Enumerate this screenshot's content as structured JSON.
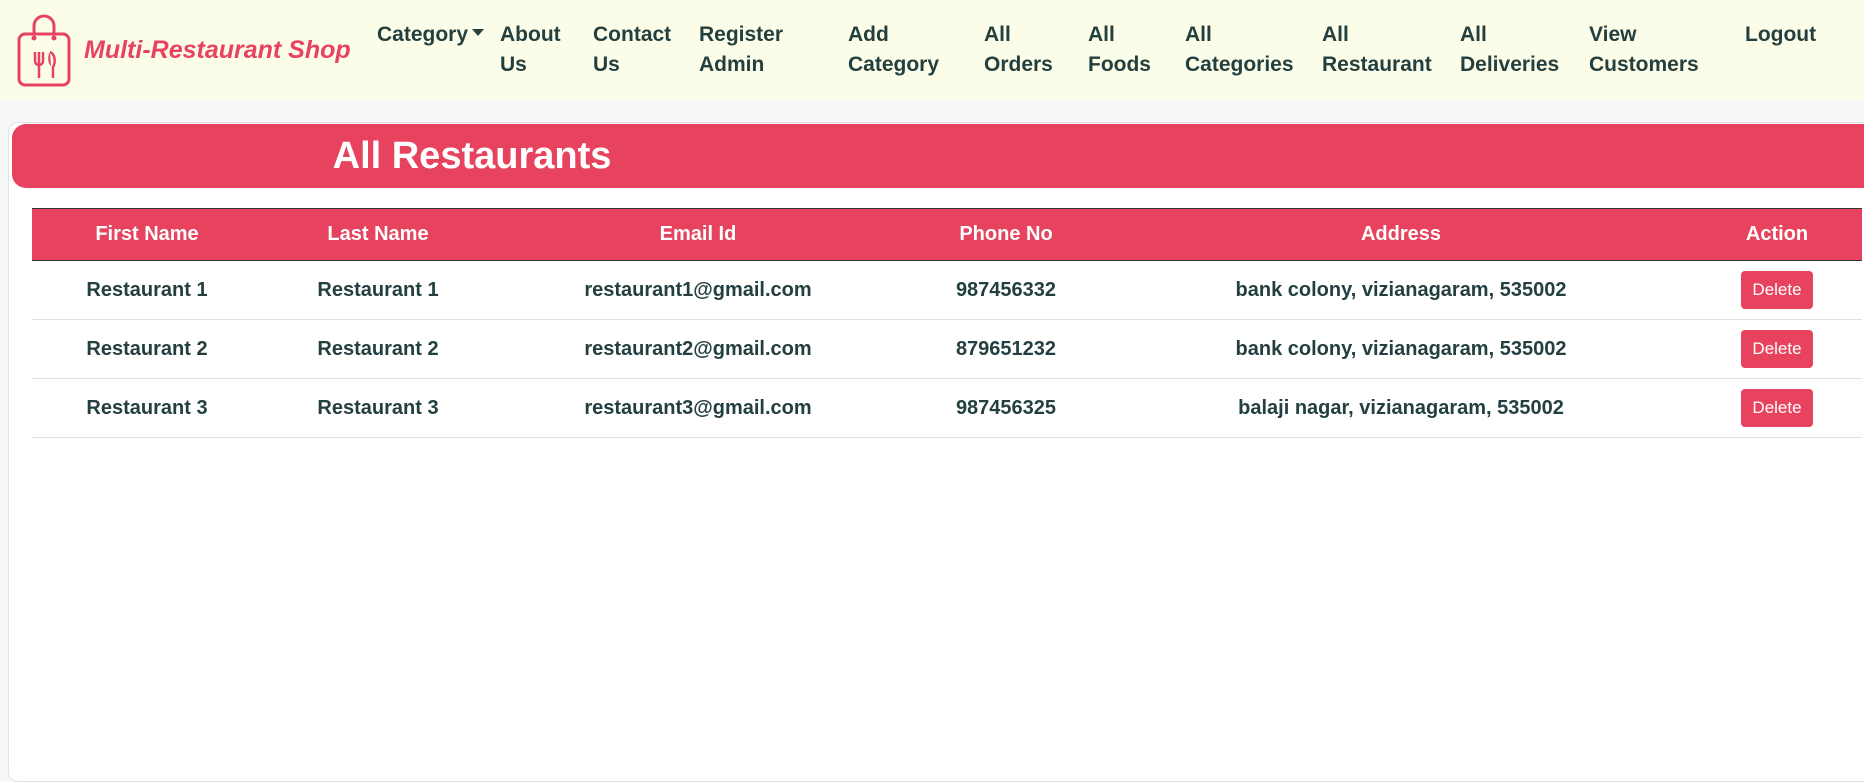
{
  "brand": {
    "name": "Multi-Restaurant Shop",
    "logo_icon": "shopping-bag-utensils-icon",
    "accent": "#e8435e"
  },
  "nav": {
    "category": "Category",
    "about_1": "About",
    "about_2": "Us",
    "contact_1": "Contact",
    "contact_2": "Us",
    "register_1": "Register",
    "register_2": "Admin",
    "addcat_1": "Add",
    "addcat_2": "Category",
    "orders_1": "All",
    "orders_2": "Orders",
    "foods_1": "All",
    "foods_2": "Foods",
    "cats_1": "All",
    "cats_2": "Categories",
    "rest_1": "All",
    "rest_2": "Restaurant",
    "deliv_1": "All",
    "deliv_2": "Deliveries",
    "cust_1": "View",
    "cust_2": "Customers",
    "logout": "Logout"
  },
  "page": {
    "title": "All Restaurants"
  },
  "table": {
    "headers": [
      "First Name",
      "Last Name",
      "Email Id",
      "Phone No",
      "Address",
      "Action"
    ],
    "rows": [
      [
        "Restaurant 1",
        "Restaurant 1",
        "restaurant1@gmail.com",
        "987456332",
        "bank colony, vizianagaram, 535002",
        "Delete"
      ],
      [
        "Restaurant 2",
        "Restaurant 2",
        "restaurant2@gmail.com",
        "879651232",
        "bank colony, vizianagaram, 535002",
        "Delete"
      ],
      [
        "Restaurant 3",
        "Restaurant 3",
        "restaurant3@gmail.com",
        "987456325",
        "balaji nagar, vizianagaram, 535002",
        "Delete"
      ]
    ]
  }
}
